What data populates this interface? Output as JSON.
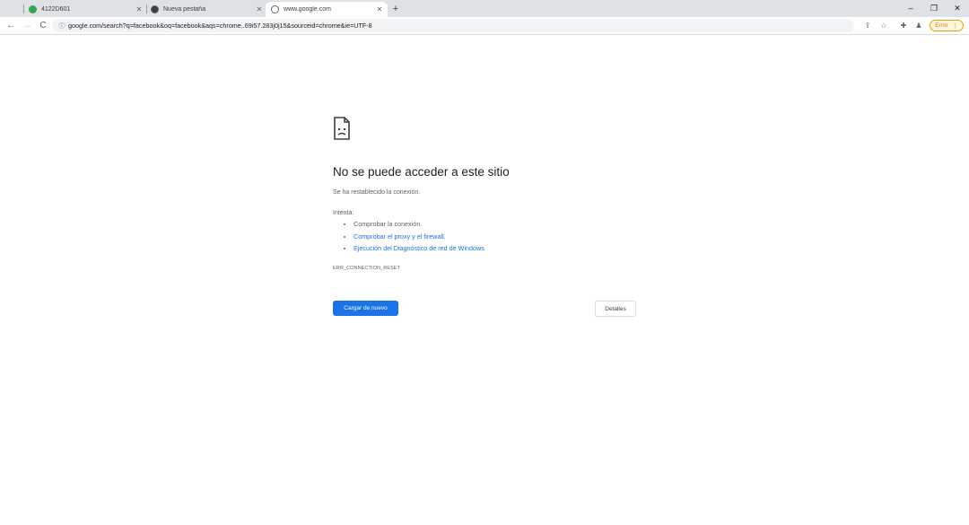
{
  "tabs": [
    {
      "title": "4122D601",
      "favicon": "green-site-icon"
    },
    {
      "title": "Nueva pestaña",
      "favicon": "chrome-icon"
    },
    {
      "title": "www.google.com",
      "favicon": "globe-icon",
      "active": true
    }
  ],
  "address_bar": {
    "url": "google.com/search?q=facebook&oq=facebook&aqs=chrome..69i57.283j0j15&sourceid=chrome&ie=UTF-8"
  },
  "profile": {
    "error_label": "Error"
  },
  "error_page": {
    "title": "No se puede acceder a este sitio",
    "subtitle": "Se ha restablecido la conexión.",
    "try_label": "Intenta:",
    "suggestions": [
      "Comprobar la conexión.",
      "Comprobar el proxy y el firewall.",
      "Ejecución del Diagnóstico de red de Windows"
    ],
    "error_code": "ERR_CONNECTION_RESET",
    "reload_button": "Cargar de nuevo",
    "details_button": "Detalles"
  },
  "colors": {
    "accent": "#1a73e8",
    "tabstrip": "#dee1e6",
    "error_pill": "#f29900"
  }
}
